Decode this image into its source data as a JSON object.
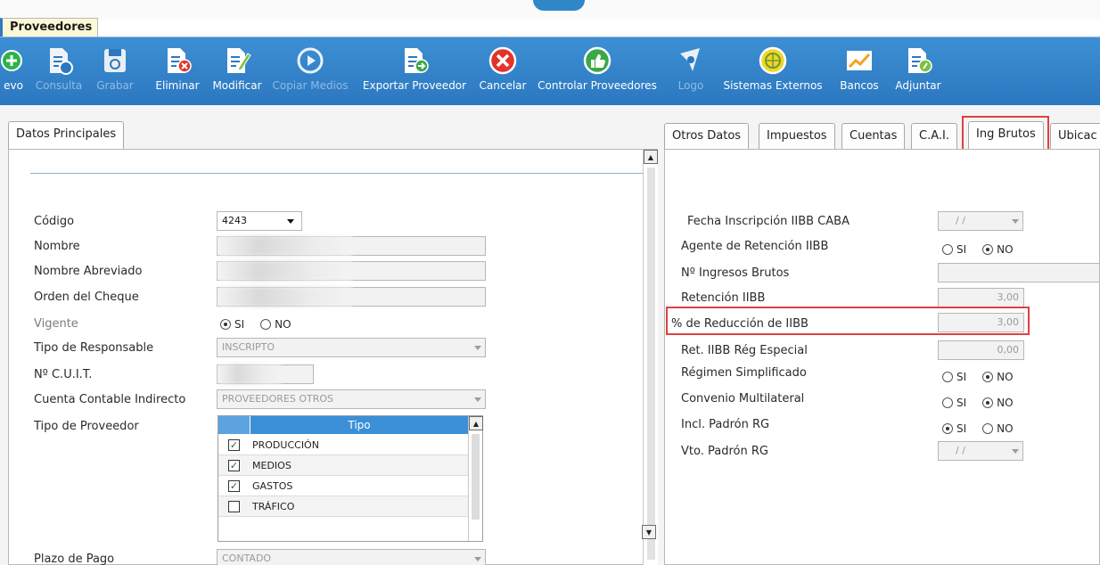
{
  "window": {
    "tab_title": "Proveedores"
  },
  "toolbar": [
    {
      "id": "nuevo",
      "label": "evo",
      "icon": "add-icon",
      "enabled": true
    },
    {
      "id": "consulta",
      "label": "Consulta",
      "icon": "document-arrow-icon",
      "enabled": false
    },
    {
      "id": "grabar",
      "label": "Grabar",
      "icon": "save-icon",
      "enabled": false
    },
    {
      "id": "eliminar",
      "label": "Eliminar",
      "icon": "delete-document-icon",
      "enabled": true
    },
    {
      "id": "modificar",
      "label": "Modificar",
      "icon": "edit-document-icon",
      "enabled": true
    },
    {
      "id": "copiar_medios",
      "label": "Copiar Medios",
      "icon": "play-icon",
      "enabled": false
    },
    {
      "id": "exportar",
      "label": "Exportar Proveedor",
      "icon": "export-document-icon",
      "enabled": true
    },
    {
      "id": "cancelar",
      "label": "Cancelar",
      "icon": "cancel-icon",
      "enabled": true
    },
    {
      "id": "controlar",
      "label": "Controlar Proveedores",
      "icon": "thumbs-up-icon",
      "enabled": true
    },
    {
      "id": "logo",
      "label": "Logo",
      "icon": "logo-icon",
      "enabled": false
    },
    {
      "id": "sistemas",
      "label": "Sistemas Externos",
      "icon": "globe-icon",
      "enabled": true
    },
    {
      "id": "bancos",
      "label": "Bancos",
      "icon": "chart-icon",
      "enabled": true
    },
    {
      "id": "adjuntar",
      "label": "Adjuntar",
      "icon": "attach-document-icon",
      "enabled": true
    }
  ],
  "left_panel": {
    "tab": "Datos Principales",
    "codigo": {
      "label": "Código",
      "value": "4243"
    },
    "nombre": {
      "label": "Nombre"
    },
    "nombre_abreviado": {
      "label": "Nombre Abreviado"
    },
    "orden_cheque": {
      "label": "Orden del Cheque"
    },
    "vigente": {
      "label": "Vigente",
      "yes": "SI",
      "no": "NO",
      "selected": "SI"
    },
    "tipo_responsable": {
      "label": "Tipo de Responsable",
      "value": "INSCRIPTO"
    },
    "cuit": {
      "label": "Nº C.U.I.T."
    },
    "cuenta_contable": {
      "label": "Cuenta Contable Indirecto",
      "value": "PROVEEDORES OTROS"
    },
    "tipo_proveedor": {
      "label": "Tipo de Proveedor",
      "column": "Tipo",
      "rows": [
        {
          "label": "PRODUCCIÓN",
          "checked": true
        },
        {
          "label": "MEDIOS",
          "checked": true
        },
        {
          "label": "GASTOS",
          "checked": true
        },
        {
          "label": "TRÁFICO",
          "checked": false
        }
      ]
    },
    "plazo_pago": {
      "label": "Plazo de Pago",
      "value": "CONTADO"
    }
  },
  "right_panel": {
    "tabs": [
      "Otros Datos",
      "Impuestos",
      "Cuentas",
      "C.A.I.",
      "Ing Brutos",
      "Ubicac"
    ],
    "active_tab": "Ing Brutos",
    "fecha_inscripcion": {
      "label": "Fecha Inscripción IIBB CABA",
      "value": "/ /"
    },
    "agente_retencion": {
      "label": "Agente de Retención IIBB",
      "yes": "SI",
      "no": "NO",
      "selected": "NO"
    },
    "nro_ingresos_brutos": {
      "label": "Nº Ingresos Brutos",
      "value": ""
    },
    "retencion": {
      "label": "Retención IIBB",
      "value": "3,00"
    },
    "reduccion": {
      "label": "% de Reducción de IIBB",
      "value": "3,00"
    },
    "ret_regimen_especial": {
      "label": "Ret. IIBB Rég Especial",
      "value": "0,00"
    },
    "regimen_simplificado": {
      "label": "Régimen Simplificado",
      "yes": "SI",
      "no": "NO",
      "selected": "NO"
    },
    "convenio_multilateral": {
      "label": "Convenio Multilateral",
      "yes": "SI",
      "no": "NO",
      "selected": "NO"
    },
    "incl_padron": {
      "label": "Incl. Padrón RG",
      "yes": "SI",
      "no": "NO",
      "selected": "SI"
    },
    "vto_padron": {
      "label": "Vto. Padrón RG",
      "value": "/ /"
    }
  },
  "colors": {
    "toolbar_blue": "#2f80c8",
    "highlight_red": "#e04040",
    "grid_header": "#3b8fd7"
  }
}
